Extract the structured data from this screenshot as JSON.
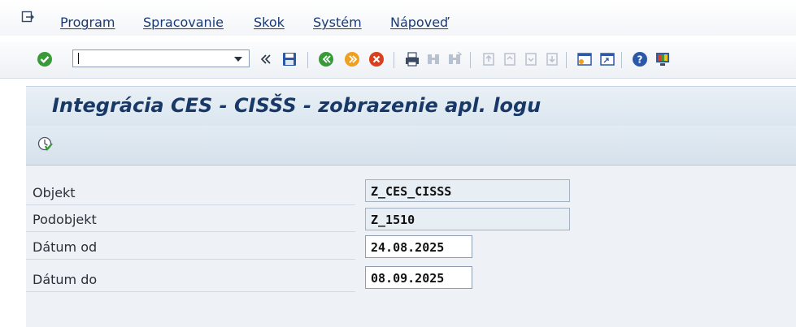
{
  "menu": {
    "items": [
      "Program",
      "Spracovanie",
      "Skok",
      "Systém",
      "Nápoveď"
    ]
  },
  "toolbar": {
    "command_value": "",
    "icons": [
      "enter-icon",
      "back-icon",
      "save-icon",
      "back-nav-icon",
      "exit-icon",
      "cancel-icon",
      "print-icon",
      "find-icon",
      "find-next-icon",
      "first-page-icon",
      "prev-page-icon",
      "next-page-icon",
      "last-page-icon",
      "new-session-icon",
      "shortcut-icon",
      "help-icon",
      "layout-icon"
    ]
  },
  "page": {
    "title": "Integrácia CES - CISŠS - zobrazenie apl. logu"
  },
  "form": {
    "fields": [
      {
        "label": "Objekt",
        "value": "Z_CES_CISSS"
      },
      {
        "label": "Podobjekt",
        "value": "Z_1510"
      },
      {
        "label": "Dátum od",
        "value": "24.08.2025"
      },
      {
        "label": "Dátum do",
        "value": "08.09.2025"
      }
    ]
  },
  "colors": {
    "accent": "#183868",
    "enter_green": "#3a9a3a"
  }
}
